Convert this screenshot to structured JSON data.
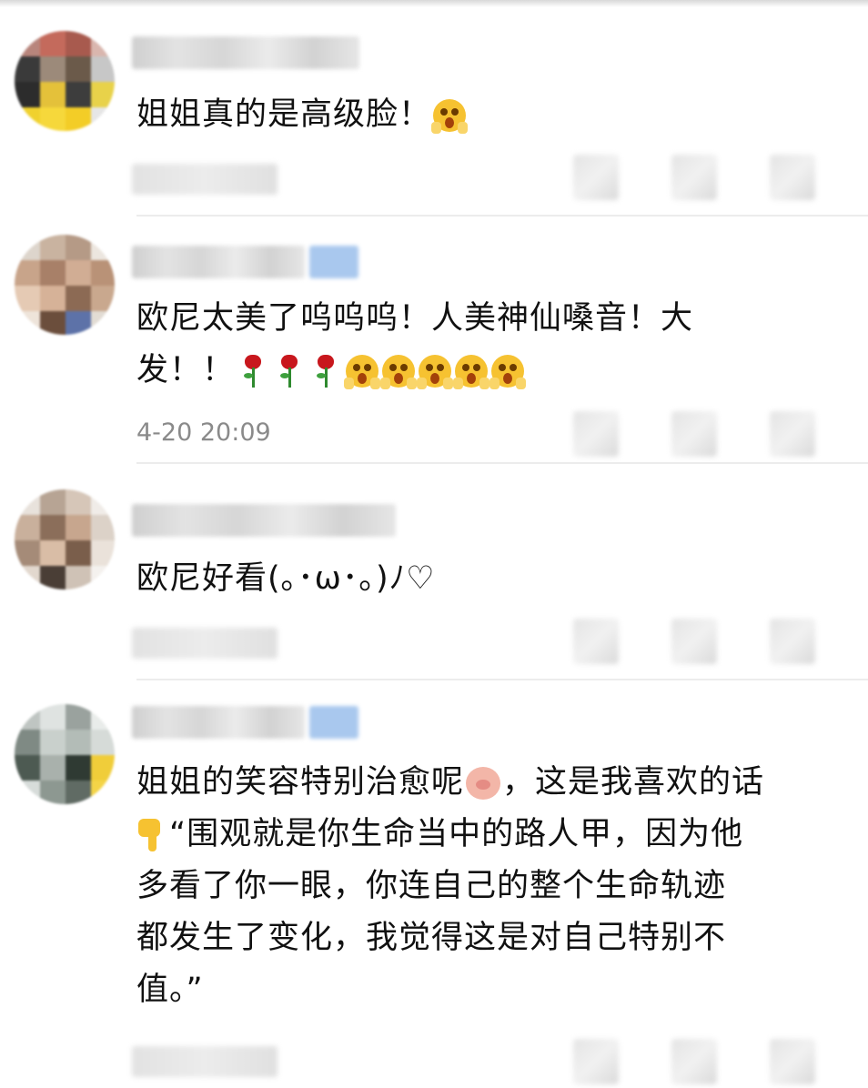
{
  "comments": [
    {
      "text": "姐姐真的是高级脸！",
      "emojis": [
        "scream-emoji"
      ],
      "time": ""
    },
    {
      "text_line1": "欧尼太美了呜呜呜！人美神仙嗓音！大",
      "text_line2": "发！！",
      "emojis": [
        "rose-emoji",
        "rose-emoji",
        "rose-emoji",
        "scream-emoji",
        "scream-emoji",
        "scream-emoji",
        "scream-emoji",
        "scream-emoji"
      ],
      "time": "4-20 20:09"
    },
    {
      "text": "欧尼好看(｡･ω･｡)ﾉ♡",
      "time": ""
    },
    {
      "text_part1": "姐姐的笑容特别治愈呢",
      "text_part2": "，这是我喜欢的话",
      "text_line2": "“围观就是你生命当中的路人甲，因为他",
      "text_line3": "多看了你一眼，你连自己的整个生命轨迹",
      "text_line4": "都发生了变化，我觉得这是对自己特别不",
      "text_line5": "值。”",
      "emojis": [
        "pig-emoji",
        "point-down-emoji"
      ],
      "time": ""
    }
  ],
  "colors": {
    "text": "#111111",
    "time": "#8a8a8a",
    "divider": "#ececec",
    "badge": "#a9c8ee"
  },
  "icons": [
    "scream-emoji",
    "rose-emoji",
    "pig-emoji",
    "point-down-emoji"
  ]
}
